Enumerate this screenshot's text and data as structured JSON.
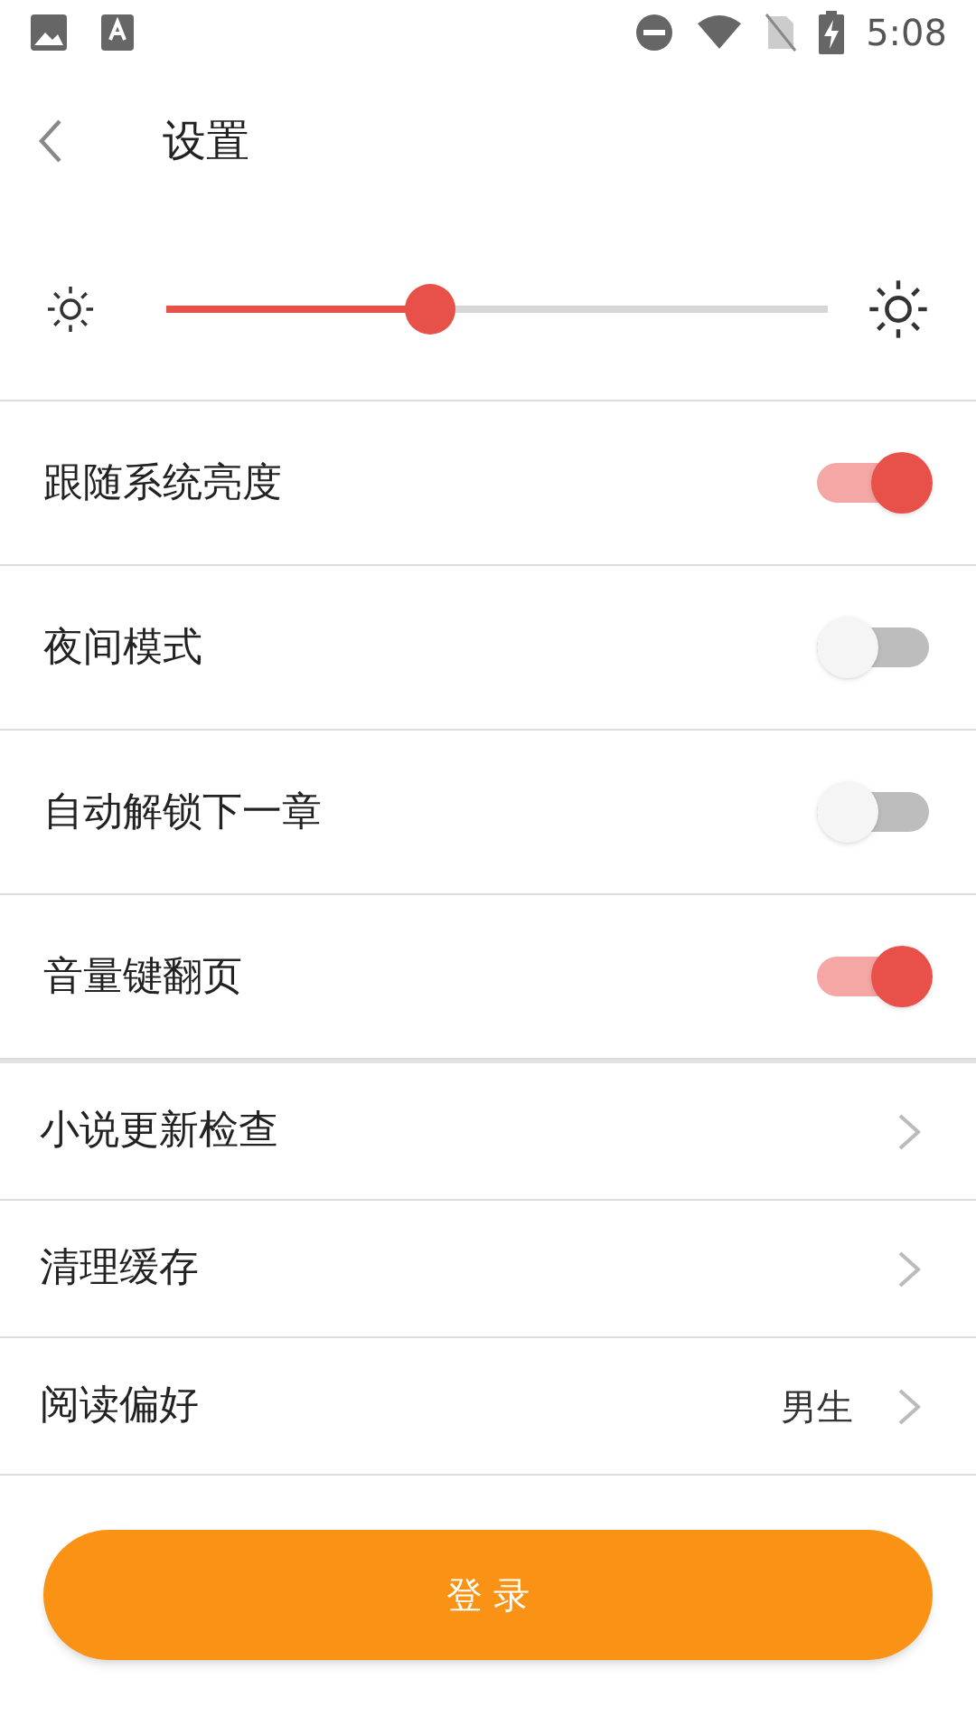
{
  "status_bar": {
    "time": "5:08"
  },
  "header": {
    "title": "设置"
  },
  "brightness": {
    "level": 0.4
  },
  "toggles": [
    {
      "label": "跟随系统亮度",
      "on": true
    },
    {
      "label": "夜间模式",
      "on": false
    },
    {
      "label": "自动解锁下一章",
      "on": false
    },
    {
      "label": "音量键翻页",
      "on": true
    }
  ],
  "links": [
    {
      "label": "小说更新检查"
    },
    {
      "label": "清理缓存"
    },
    {
      "label": "阅读偏好",
      "value": "男生"
    }
  ],
  "login_button": {
    "label": "登 录"
  }
}
